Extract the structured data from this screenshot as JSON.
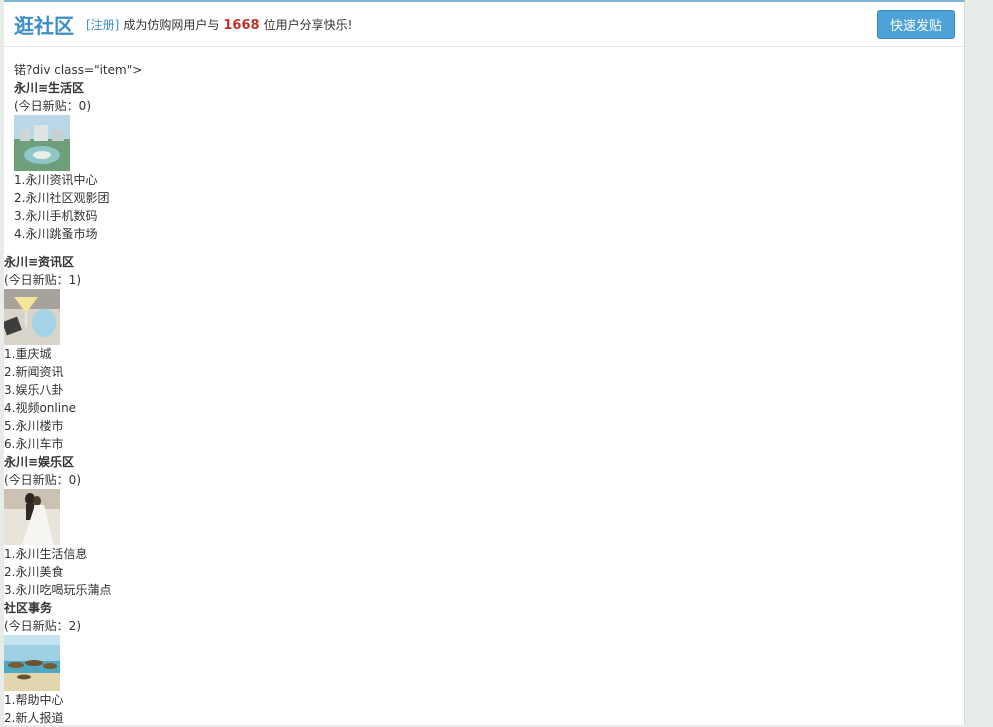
{
  "header": {
    "title": "逛社区",
    "register_link": "[注册]",
    "welcome_prefix": "成为仿购网用户与",
    "user_count": "1668",
    "welcome_suffix": "位用户分享快乐!",
    "post_button": "快速发贴"
  },
  "stray_text": "锘?div class=\"item\">",
  "categories": [
    {
      "title": "永川≡生活区",
      "today": "(今日新贴：0)",
      "forums": [
        "1.永川资讯中心",
        "2.永川社区观影团",
        "3.永川手机数码",
        "4.永川跳蚤市场"
      ]
    },
    {
      "title": "永川≡资讯区",
      "today": "(今日新贴：1)",
      "forums": [
        "1.重庆城",
        "2.新闻资讯",
        "3.娱乐八卦",
        "4.视频online",
        "5.永川楼市",
        "6.永川车市"
      ]
    },
    {
      "title": "永川≡娱乐区",
      "today": "(今日新贴：0)",
      "forums": [
        "1.永川生活信息",
        "2.永川美食",
        "3.永川吃喝玩乐蒲点"
      ]
    },
    {
      "title": "社区事务",
      "today": "(今日新贴：2)",
      "forums": [
        "1.帮助中心",
        "2.新人报道"
      ]
    }
  ]
}
